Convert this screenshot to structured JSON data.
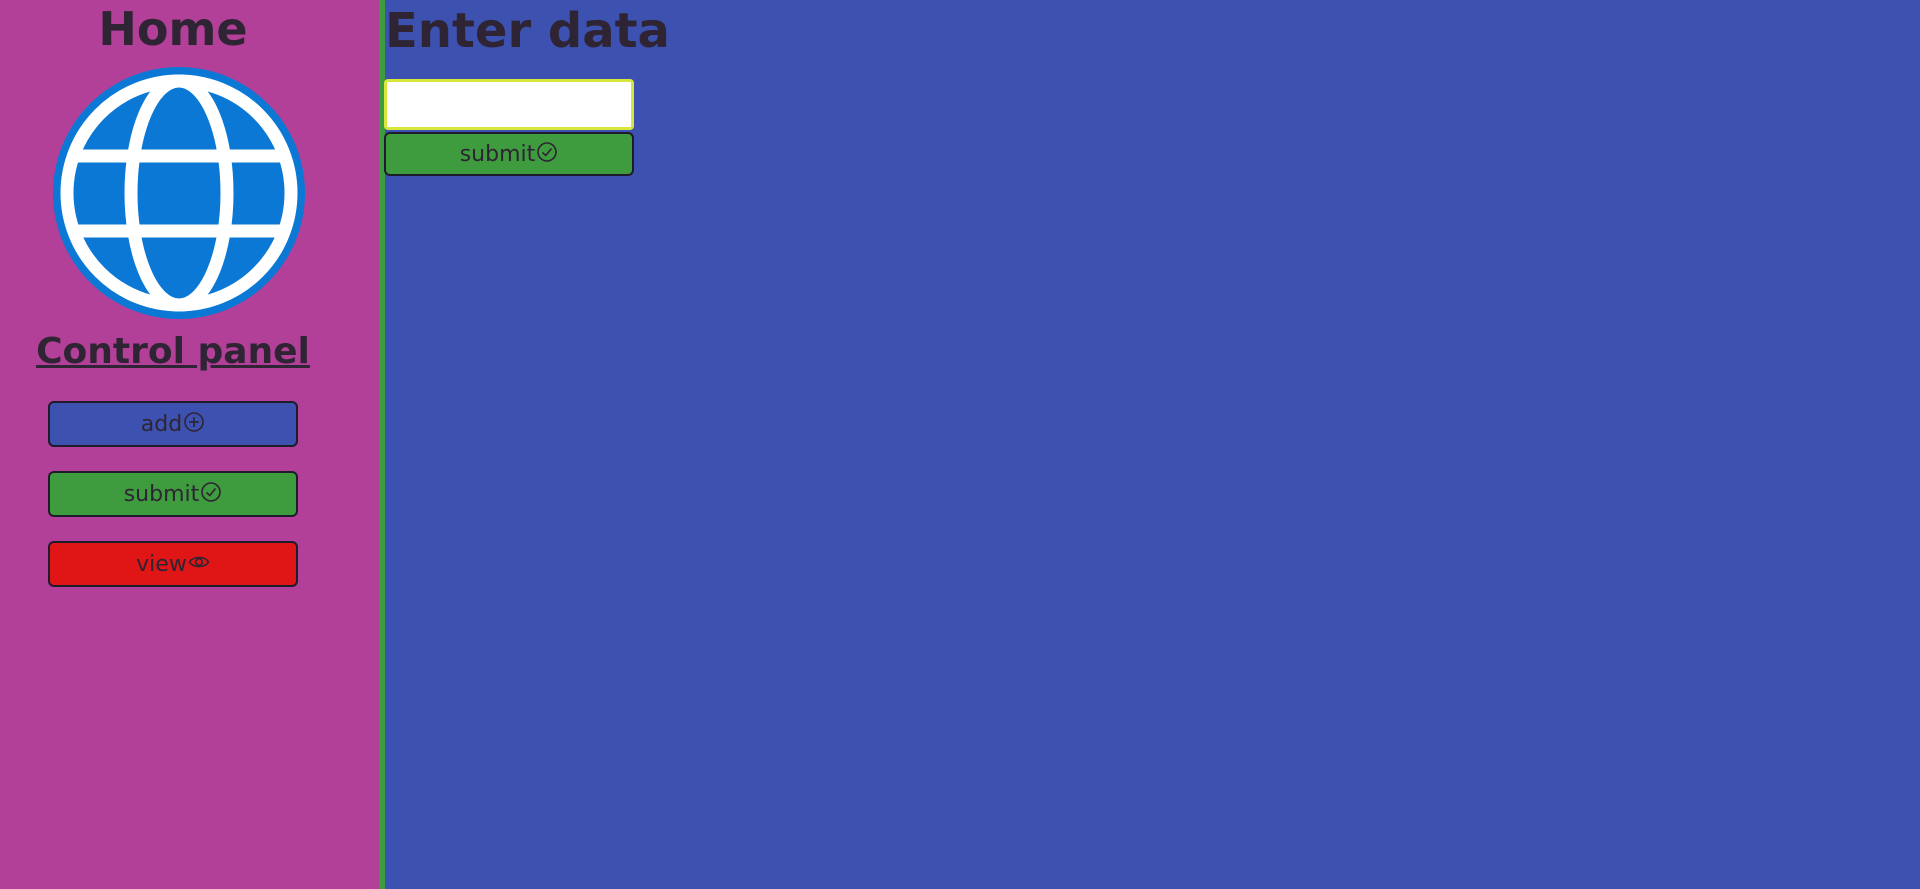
{
  "sidebar": {
    "title": "Home",
    "logo_icon": "globe-icon",
    "panel_title": "Control panel",
    "buttons": [
      {
        "label": "add",
        "icon": "plus-circle-icon",
        "color": "#3d52b0"
      },
      {
        "label": "submit",
        "icon": "check-circle-icon",
        "color": "#3e9b3e"
      },
      {
        "label": "view",
        "icon": "eye-icon",
        "color": "#e01515"
      }
    ]
  },
  "main": {
    "title": "Enter data",
    "input": {
      "value": "",
      "placeholder": ""
    },
    "submit_label": "submit",
    "submit_icon": "check-circle-icon"
  },
  "colors": {
    "sidebar_bg": "#b23f98",
    "main_bg": "#3d52b0",
    "divider": "#3e9b3e",
    "globe": "#0a78d4"
  }
}
